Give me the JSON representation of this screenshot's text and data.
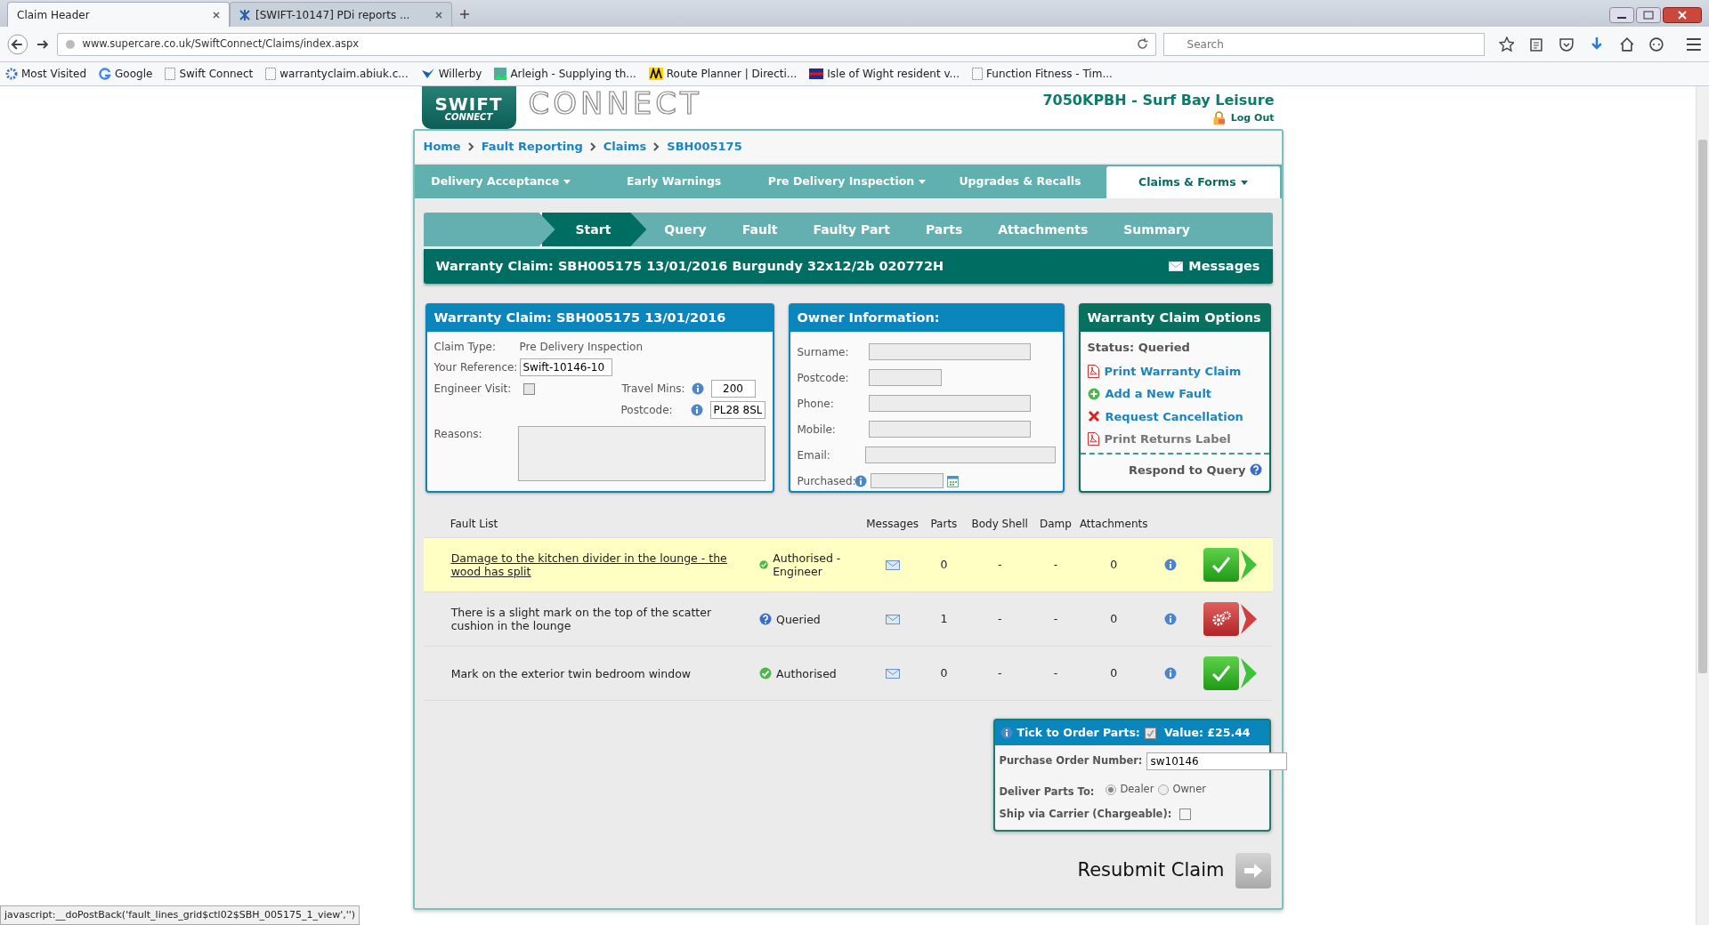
{
  "browser": {
    "tabs": [
      {
        "title": "Claim Header",
        "selected": true
      },
      {
        "title": "[SWIFT-10147] PDi reports ...",
        "selected": false
      }
    ],
    "url": "www.supercare.co.uk/SwiftConnect/Claims/index.aspx",
    "search": {
      "placeholder": "Search"
    },
    "bookmarks": [
      {
        "label": "Most Visited",
        "kind": "gear"
      },
      {
        "label": "Google",
        "kind": "g"
      },
      {
        "label": "Swift Connect",
        "kind": "page"
      },
      {
        "label": "warrantyclaim.abiuk.c...",
        "kind": "page"
      },
      {
        "label": "Willerby",
        "kind": "bird"
      },
      {
        "label": "Arleigh - Supplying th...",
        "kind": "pic"
      },
      {
        "label": "Route Planner | Directi...",
        "kind": "aa"
      },
      {
        "label": "Isle of Wight resident v...",
        "kind": "flag"
      },
      {
        "label": "Function Fitness - Tim...",
        "kind": "page"
      }
    ],
    "status_text": "javascript:__doPostBack('fault_lines_grid$ctl02$SBH_005175_1_view','')"
  },
  "header": {
    "logo": [
      "SWIFT",
      "CONNECT"
    ],
    "brand": "CONNECT",
    "dealer": "7050KPBH - Surf Bay Leisure",
    "logout": "Log Out"
  },
  "breadcrumb": [
    "Home",
    "Fault Reporting",
    "Claims",
    "SBH005175"
  ],
  "nav": [
    {
      "label": "Delivery Acceptance",
      "dropdown": true,
      "selected": false
    },
    {
      "label": "Early Warnings",
      "dropdown": false,
      "selected": false
    },
    {
      "label": "Pre Delivery Inspection",
      "dropdown": true,
      "selected": false
    },
    {
      "label": "Upgrades & Recalls",
      "dropdown": false,
      "selected": false
    },
    {
      "label": "Claims & Forms",
      "dropdown": true,
      "selected": true
    }
  ],
  "steps": [
    {
      "label": "Start",
      "selected": true
    },
    {
      "label": "Query",
      "selected": false
    },
    {
      "label": "Fault",
      "selected": false
    },
    {
      "label": "Faulty Part",
      "selected": false
    },
    {
      "label": "Parts",
      "selected": false
    },
    {
      "label": "Attachments",
      "selected": false
    },
    {
      "label": "Summary",
      "selected": false
    }
  ],
  "claim_bar": {
    "title": "Warranty Claim: SBH005175 13/01/2016 Burgundy 32x12/2b 020772H",
    "messages": "Messages"
  },
  "claim_panel": {
    "title": "Warranty Claim: SBH005175 13/01/2016",
    "claim_type_label": "Claim Type:",
    "claim_type": "Pre Delivery Inspection",
    "reference_label": "Your Reference:",
    "reference": "Swift-10146-10",
    "engineer_label": "Engineer Visit:",
    "engineer_visit": false,
    "travel_label": "Travel Mins:",
    "travel": "200",
    "postcode_label": "Postcode:",
    "postcode": "PL28 8SL",
    "reasons_label": "Reasons:"
  },
  "owner_panel": {
    "title": "Owner Information:",
    "fields": [
      {
        "label": "Surname:",
        "kind": "text"
      },
      {
        "label": "Postcode:",
        "kind": "text"
      },
      {
        "label": "Phone:",
        "kind": "text"
      },
      {
        "label": "Mobile:",
        "kind": "text"
      },
      {
        "label": "Email:",
        "kind": "text"
      },
      {
        "label": "Purchased:",
        "kind": "date"
      }
    ]
  },
  "options_panel": {
    "title": "Warranty Claim Options",
    "status": "Status: Queried",
    "links": [
      {
        "label": "Print Warranty Claim",
        "kind": "pdf",
        "disabled": false
      },
      {
        "label": "Add a New Fault",
        "kind": "plus",
        "disabled": false
      },
      {
        "label": "Request Cancellation",
        "kind": "cross",
        "disabled": false
      },
      {
        "label": "Print Returns Label",
        "kind": "pdf",
        "disabled": true
      }
    ],
    "respond": "Respond to Query"
  },
  "fault_table": {
    "columns": [
      "Fault List",
      "Messages",
      "Parts",
      "Body Shell",
      "Damp",
      "Attachments"
    ],
    "rows": [
      {
        "description": "Damage to the kitchen divider in the lounge - the wood has split",
        "highlighted": true,
        "status": "Authorised - Engineer",
        "kind": "authorised",
        "parts": "0",
        "body_shell": "-",
        "damp": "-",
        "attachments": "0"
      },
      {
        "description": "There is a slight mark on the top of the scatter cushion in the lounge",
        "highlighted": false,
        "status": "Queried",
        "kind": "queried",
        "parts": "1",
        "body_shell": "-",
        "damp": "-",
        "attachments": "0"
      },
      {
        "description": "Mark on the exterior twin bedroom window",
        "highlighted": false,
        "status": "Authorised",
        "kind": "authorised",
        "parts": "0",
        "body_shell": "-",
        "damp": "-",
        "attachments": "0"
      }
    ]
  },
  "order_parts": {
    "tick_label": "Tick to Order Parts:",
    "checked": true,
    "value": "Value: £25.44",
    "po_label": "Purchase Order Number:",
    "po_number": "sw10146",
    "deliver_label": "Deliver Parts To:",
    "deliver_options": [
      {
        "label": "Dealer",
        "selected": true
      },
      {
        "label": "Owner",
        "selected": false
      }
    ],
    "carrier_label": "Ship via Carrier (Chargeable):",
    "carrier": false
  },
  "resubmit": "Resubmit Claim"
}
